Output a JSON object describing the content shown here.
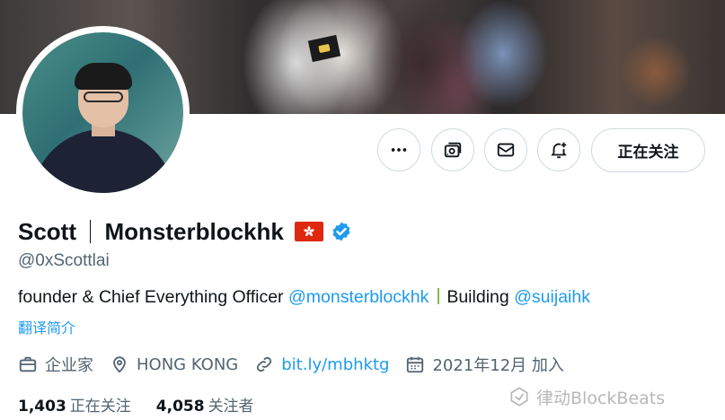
{
  "header": {
    "banner_alt": "group photo banner"
  },
  "actions": {
    "more_icon": "more-horizontal-icon",
    "subscribe_icon": "subscriptions-icon",
    "message_icon": "envelope-icon",
    "notify_icon": "bell-plus-icon",
    "follow_label": "正在关注"
  },
  "profile": {
    "display_name_first": "Scott",
    "display_name_second": "Monsterblockhk",
    "flag": "hong-kong-flag",
    "verified_icon": "verified-badge-icon",
    "handle": "@0xScottlai",
    "bio": {
      "text_1": "founder & Chief Everything Officer ",
      "mention_1": "@monsterblockhk",
      "text_2": "Building ",
      "mention_2": "@suijaihk"
    },
    "translate_label": "翻译简介"
  },
  "meta": {
    "category": "企业家",
    "location": "HONG KONG",
    "website": "bit.ly/mbhktg",
    "joined": "2021年12月 加入"
  },
  "stats": {
    "following_count": "1,403",
    "following_label": "正在关注",
    "followers_count": "4,058",
    "followers_label": "关注者"
  },
  "watermark": {
    "text": "律动BlockBeats"
  },
  "colors": {
    "accent": "#1d9bf0",
    "text": "#0f1419",
    "secondary": "#536471",
    "border": "#cfd9de",
    "flag_red": "#de2910"
  }
}
